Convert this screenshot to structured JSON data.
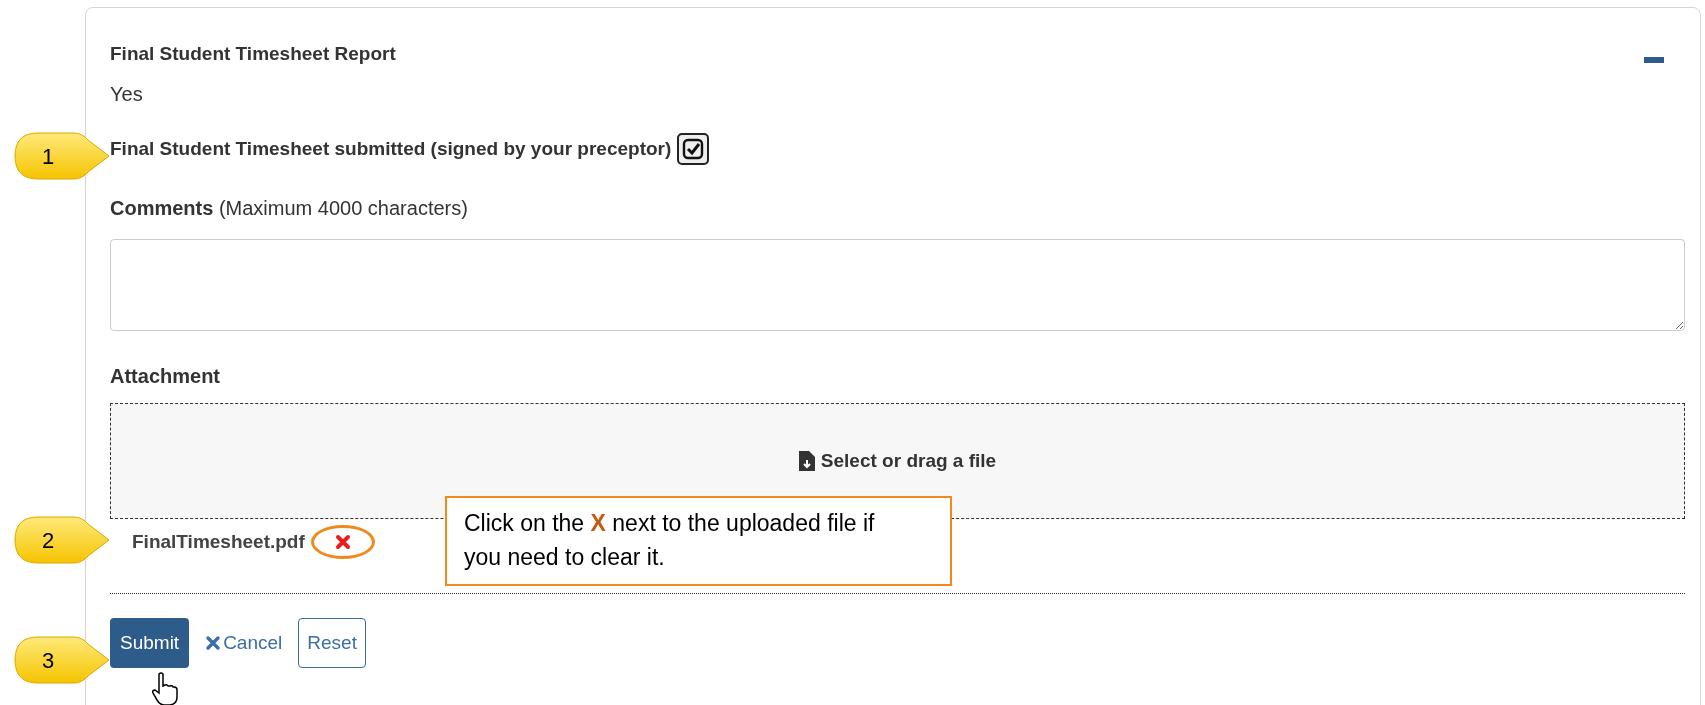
{
  "section": {
    "title": "Final Student Timesheet Report",
    "value": "Yes",
    "expanded": true
  },
  "confirm": {
    "label": "Final Student Timesheet submitted (signed by your preceptor)",
    "checked": true
  },
  "comments": {
    "label": "**Comments** (Maximum 4000 characters)"
  },
  "attachment": {
    "label": "Attachment",
    "dropzone": "Select or drag a file",
    "files": [
      {
        "name": "FinalTimesheet.pdf"
      }
    ]
  },
  "buttons": [
    {
      "kind": "primary",
      "label": "Submit"
    },
    {
      "kind": "link",
      "label": "Cancel"
    },
    {
      "kind": "outline",
      "label": "Reset"
    }
  ],
  "callouts": [
    {
      "number": "1"
    },
    {
      "number": "2"
    },
    {
      "number": "3"
    }
  ],
  "note": {
    "text": "Click on the **X** next to the uploaded file if you need to clear it."
  }
}
